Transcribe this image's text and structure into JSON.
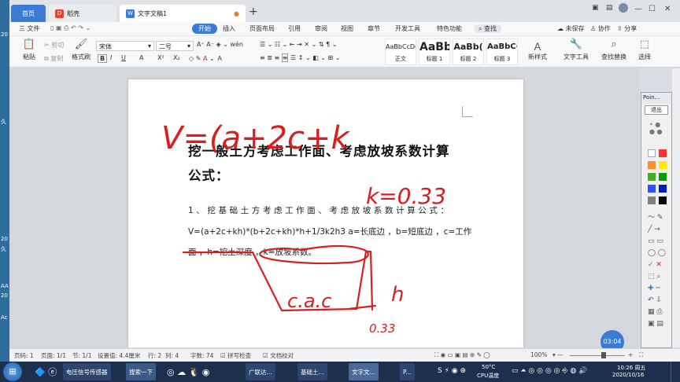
{
  "left_strip": {
    "texts": [
      "20",
      "久",
      "20",
      "久",
      "AA",
      "20",
      "Ac"
    ]
  },
  "tabs": {
    "home": "首页",
    "daoke": "稻壳",
    "doc": "文字文稿1"
  },
  "window": {
    "minimize": "—",
    "restore": "☐",
    "close": "✕"
  },
  "menu": {
    "file": "三 文件",
    "tabs": [
      "开始",
      "插入",
      "页面布局",
      "引用",
      "审阅",
      "视图",
      "章节",
      "开发工具",
      "特色功能"
    ],
    "search": "查找",
    "unsaved": "未保存",
    "collab": "协作",
    "share": "分享"
  },
  "toolbar": {
    "paste": "粘贴",
    "cut": "剪切",
    "copy": "复制",
    "format_painter": "格式刷",
    "font_name": "宋体",
    "font_size": "二号",
    "bold": "B",
    "italic": "I",
    "underline": "U",
    "strike": "A",
    "superscript": "X²",
    "subscript": "X₂",
    "styles": [
      {
        "preview": "AaBbCcDd",
        "name": "正文"
      },
      {
        "preview": "AaBb",
        "name": "标题 1"
      },
      {
        "preview": "AaBb(",
        "name": "标题 2"
      },
      {
        "preview": "AaBbC(",
        "name": "标题 3"
      }
    ],
    "new_style": "新样式",
    "text_tools": "文字工具",
    "find_replace": "查找替换",
    "select": "选择"
  },
  "document": {
    "title_line1": "挖一般土方考虑工作面、考虑放坡系数计算",
    "title_line2": "公式：",
    "para1": "1、挖基础土方考虑工作面、考虑放坡系数计算公式：",
    "para2": "V=(a+2c+kh)*(b+2c+kh)*h+1/3k2h3 a=长底边 ，b=短底边 ，c=工作",
    "para3a": "面 ，h=挖土深度 ，",
    "para3b": "k=放坡系数。"
  },
  "ink_notes": {
    "formula": "V=(a+2c+k",
    "k_value": "k=0.33",
    "bottom": "c.a.c",
    "h": "h",
    "slope": "0.33"
  },
  "pointer_panel": {
    "title": "Poin...",
    "exit": "退出"
  },
  "timer": "03:04",
  "status": {
    "page_no": "页码: 1",
    "pages": "页面: 1/1",
    "section": "节: 1/1",
    "set_value": "设置值: 4.4厘米",
    "row": "行: 2",
    "col": "列: 4",
    "words": "字数: 74",
    "spell": "拼写检查",
    "proofread": "文档校对",
    "zoom": "100%"
  },
  "taskbar": {
    "items": [
      "电压信号传感器",
      "搜索一下",
      "广联达...",
      "基础土...",
      "文字文...",
      "P..."
    ],
    "temp": "50°C",
    "cpu": "CPU温度",
    "time": "10:26 周五",
    "date": "2020/10/16"
  },
  "colors": {
    "accent": "#3a7bd5",
    "ink_red": "#d62020",
    "swatches": [
      "#ffffff",
      "#ff3030",
      "#ff8c2a",
      "#ffea00",
      "#40b020",
      "#00a000",
      "#3050ff",
      "#0018c0",
      "#808080",
      "#000000"
    ]
  }
}
